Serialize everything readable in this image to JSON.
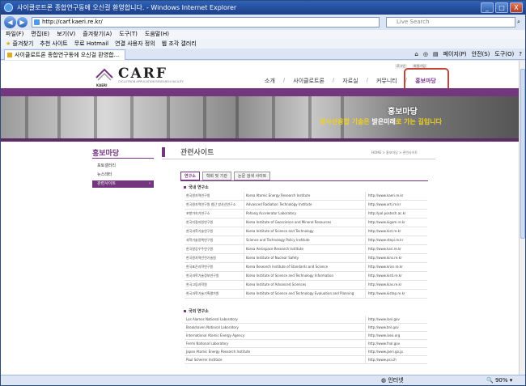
{
  "browser": {
    "title": "사이클로트론 종합연구동에 오신걸 환영합니다. - Windows Internet Explorer",
    "window_buttons": [
      "_",
      "□",
      "X"
    ],
    "address": "http://carf.kaeri.re.kr/",
    "search_placeholder": "Live Search",
    "menu": [
      "파일(F)",
      "편집(E)",
      "보기(V)",
      "즐겨찾기(A)",
      "도구(T)",
      "도움말(H)"
    ],
    "favorites": [
      "즐겨찾기",
      "추천 사이트",
      "무료 Hotmail",
      "연결 사용자 정의",
      "웹 조각 갤러리"
    ],
    "tab_label": "사이클로트론 종합연구동에 오신걸 환영합...",
    "tools": [
      "페이지(P)",
      "안전(S)",
      "도구(O)"
    ],
    "status_zone": "인터넷",
    "zoom": "90%",
    "accent": "#2f62b8"
  },
  "site": {
    "logo": "CARF",
    "logo_sub": "CYCLOTRON APPLICATION RESEARCH FACILITY",
    "org": "KAERI",
    "util_links": [
      "로그인",
      "회원가입"
    ],
    "gnb": [
      "소개",
      "사이클로트론",
      "자료실",
      "커뮤니티",
      "홍보마당"
    ],
    "gnb_active": "홍보마당",
    "banner_title": "홍보마당",
    "banner_sub_pre": "방사선융합 기술은 ",
    "banner_sub_hl": "밝은미래",
    "banner_sub_post": "로 가는 길입니다",
    "brand_color": "#74367f"
  },
  "sidebar": {
    "title": "홍보마당",
    "items": [
      {
        "label": "포토갤러리",
        "active": false
      },
      {
        "label": "뉴스레터",
        "active": false
      },
      {
        "label": "관련사이트",
        "active": true
      }
    ]
  },
  "content": {
    "title": "관련사이트",
    "breadcrumb": "HOME > 홍보마당 > 관련사이트",
    "tabs": [
      "연구소",
      "학회 및 기관",
      "논문 검색 사이트"
    ],
    "domestic_title": "국내 연구소",
    "domestic": [
      {
        "kr": "한국원자력연구원",
        "en": "Korea Atomic Energy Research Institute",
        "url": "http://www.kaeri.re.kr"
      },
      {
        "kr": "한국원자력연구원 첨단 방사선연구소",
        "en": "Advanced Radiation Technology Institute",
        "url": "http://www.arti.re.kr"
      },
      {
        "kr": "포항가속기연구소",
        "en": "Pohang Accelerator Laboratory",
        "url": "http://pal.postech.ac.kr"
      },
      {
        "kr": "한국지질자원연구원",
        "en": "Korea Institute of Geoscience and Mineral Resources",
        "url": "http://www.kigam.re.kr"
      },
      {
        "kr": "한국과학기술연구원",
        "en": "Korea Institute of Science and Technology",
        "url": "http://www.kist.re.kr"
      },
      {
        "kr": "과학기술정책연구원",
        "en": "Science and Technology Policy Institute",
        "url": "http://www.stepi.re.kr"
      },
      {
        "kr": "한국항공우주연구원",
        "en": "Korea Aerospace Research Institute",
        "url": "http://www.kari.re.kr"
      },
      {
        "kr": "한국원자력안전기술원",
        "en": "Korea Institute of Nuclear Safety",
        "url": "http://www.kins.re.kr"
      },
      {
        "kr": "한국표준과학연구원",
        "en": "Korea Research Institute of Standards and Science",
        "url": "http://www.kriss.re.kr"
      },
      {
        "kr": "한국과학기술정보연구원",
        "en": "Korea Institute of Science and Technology Information",
        "url": "http://www.kisti.re.kr"
      },
      {
        "kr": "한국고등과학원",
        "en": "Korea Institute of Advanced Sciences",
        "url": "http://www.kias.re.kr"
      },
      {
        "kr": "한국과학기술기획평가원",
        "en": "Korea Institute of Science and Technology Evaluation and Planning",
        "url": "http://www.kistep.re.kr"
      }
    ],
    "foreign_title": "국외 연구소",
    "foreign": [
      {
        "name": "Los Alamos National Laboratory",
        "url": "http://www.lanl.gov"
      },
      {
        "name": "Brookhaven National Laboratory",
        "url": "http://www.bnl.gov"
      },
      {
        "name": "International Atomic Energy Agency",
        "url": "http://www.iaea.org"
      },
      {
        "name": "Fermi National Laboratory",
        "url": "http://www.fnal.gov"
      },
      {
        "name": "Japan Atomic Energy Research Institute",
        "url": "http://www.jaeri.go.jp"
      },
      {
        "name": "Paul Scherrer Institute",
        "url": "http://www.psi.ch"
      }
    ]
  }
}
